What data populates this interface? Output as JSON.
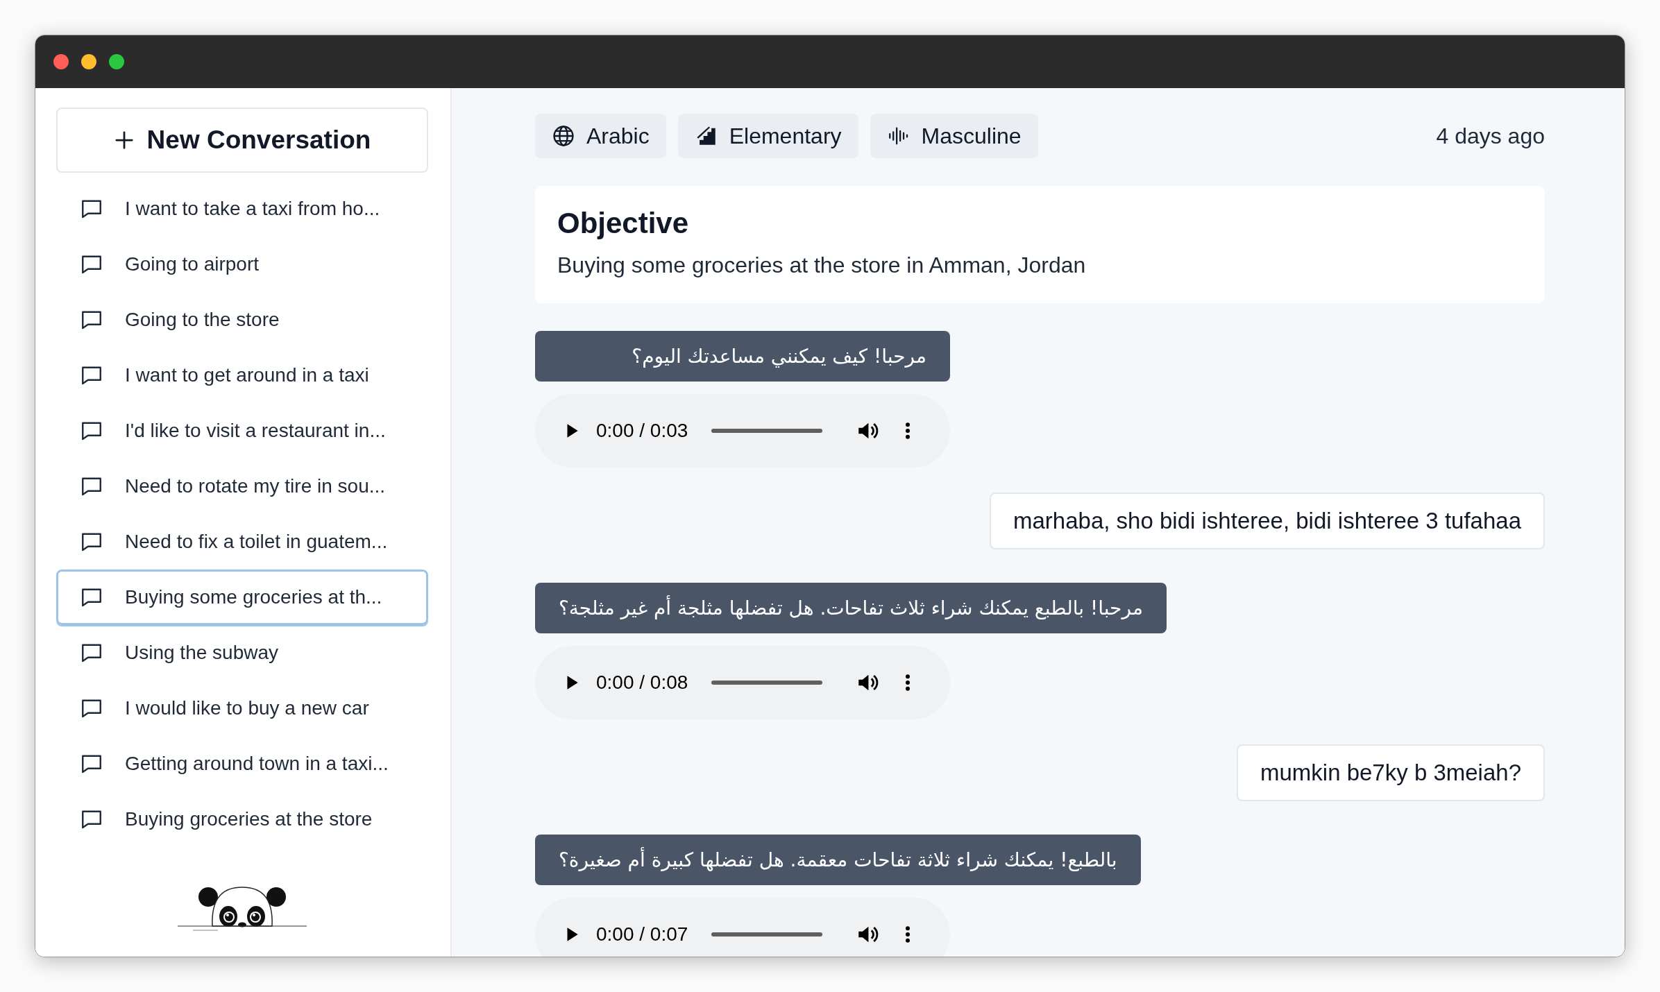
{
  "window": {
    "controls": [
      {
        "color": "#ff5f57"
      },
      {
        "color": "#febc2e"
      },
      {
        "color": "#28c840"
      }
    ]
  },
  "sidebar": {
    "new_button": {
      "label": "New Conversation"
    },
    "conversations": [
      {
        "title": "I want to take a taxi from ho...",
        "selected": false
      },
      {
        "title": "Going to airport",
        "selected": false
      },
      {
        "title": "Going to the store",
        "selected": false
      },
      {
        "title": "I want to get around in a taxi",
        "selected": false
      },
      {
        "title": "I'd like to visit a restaurant in...",
        "selected": false
      },
      {
        "title": "Need to rotate my tire in sou...",
        "selected": false
      },
      {
        "title": "Need to fix a toilet in guatem...",
        "selected": false
      },
      {
        "title": "Buying some groceries at th...",
        "selected": true
      },
      {
        "title": "Using the subway",
        "selected": false
      },
      {
        "title": "I would like to buy a new car",
        "selected": false
      },
      {
        "title": "Getting around town in a taxi...",
        "selected": false
      },
      {
        "title": "Buying groceries at the store",
        "selected": false
      }
    ]
  },
  "chips": [
    {
      "kind": "language",
      "label": "Arabic"
    },
    {
      "kind": "level",
      "label": "Elementary"
    },
    {
      "kind": "voice",
      "label": "Masculine"
    }
  ],
  "timestamp": "4 days ago",
  "objective": {
    "title": "Objective",
    "text": "Buying some groceries at the store in Amman, Jordan"
  },
  "messages": [
    {
      "kind": "bot",
      "text": "مرحبا! كيف يمكنني مساعدتك اليوم؟",
      "audio": {
        "time": "0:00 / 0:03"
      }
    },
    {
      "kind": "user",
      "text": "marhaba, sho bidi ishteree, bidi ishteree 3 tufahaa"
    },
    {
      "kind": "bot",
      "text": "مرحبا! بالطبع يمكنك شراء ثلاث تفاحات. هل تفضلها مثلجة أم غير مثلجة؟",
      "audio": {
        "time": "0:00 / 0:08"
      }
    },
    {
      "kind": "user",
      "text": "mumkin be7ky b 3meiah?"
    },
    {
      "kind": "bot",
      "text": "بالطبع! يمكنك شراء ثلاثة تفاحات معقمة. هل تفضلها كبيرة أم صغيرة؟",
      "audio": {
        "time": "0:00 / 0:07"
      }
    }
  ]
}
